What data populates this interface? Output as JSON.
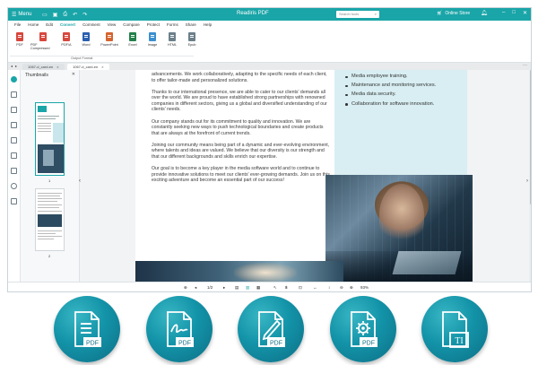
{
  "titlebar": {
    "menu_label": "Menu",
    "app_title": "Readiris PDF",
    "search_placeholder": "Search tools",
    "store_label": "Online Store"
  },
  "menubar": [
    "File",
    "Home",
    "Edit",
    "Convert",
    "Comment",
    "View",
    "Compare",
    "Protect",
    "Forms",
    "Share",
    "Help"
  ],
  "menubar_active": "Convert",
  "ribbon": {
    "tools": [
      {
        "label": "PDF",
        "color": "#d8473e"
      },
      {
        "label": "PDF Compressed",
        "color": "#d8473e"
      },
      {
        "label": "PDF/A",
        "color": "#d8473e"
      },
      {
        "label": "Word",
        "color": "#2b5faf"
      },
      {
        "label": "PowerPoint",
        "color": "#d5642f"
      },
      {
        "label": "Excel",
        "color": "#24804a"
      },
      {
        "label": "Image",
        "color": "#3a8fd0"
      },
      {
        "label": "HTML",
        "color": "#6b7f8a"
      },
      {
        "label": "Epub",
        "color": "#6b7f8a"
      }
    ],
    "group_label": "Output Format"
  },
  "tabs": [
    {
      "label": "1067-d_card-en",
      "active": false
    },
    {
      "label": "1067-d_card-en",
      "active": true
    }
  ],
  "thumbnails": {
    "title": "Thumbnails",
    "page1_num": "1",
    "page2_num": "2"
  },
  "document": {
    "paragraphs": [
      "advancements. We work collaboratively, adapting to the specific needs of each client, to offer tailor-made and personalized solutions.",
      "Thanks to our international presence, we are able to cater to our clients' demands all over the world. We are proud to have established strong partnerships with renowned companies in different sectors, giving us a global and diversified understanding of our clients' needs.",
      "Our company stands out for its commitment to quality and innovation. We are constantly seeking new ways to push technological boundaries and create products that are always at the forefront of current trends.",
      "Joining our community means being part of a dynamic and ever-evolving environment, where talents and ideas are valued. We believe that our diversity is our strength and that our different backgrounds and skills enrich our expertise.",
      "Our goal is to become a key player in the media software world and to continue to provide innovative solutions to meet our clients' ever-growing demands. Join us on this exciting adventure and become an essential part of our success!"
    ],
    "bullets": [
      "Media employee training.",
      "Maintenance and monitoring services.",
      "Media data security.",
      "Collaboration for software innovation."
    ]
  },
  "bottombar": {
    "page_indicator": "1/2",
    "zoom": "93%"
  },
  "format_icons": [
    {
      "name": "pdf-document-icon",
      "label": "PDF"
    },
    {
      "name": "pdf-signature-icon",
      "label": "PDF"
    },
    {
      "name": "pdf-edit-icon",
      "label": "PDF"
    },
    {
      "name": "pdf-settings-icon",
      "label": "PDF"
    },
    {
      "name": "text-recognition-icon",
      "label": "TI"
    }
  ]
}
